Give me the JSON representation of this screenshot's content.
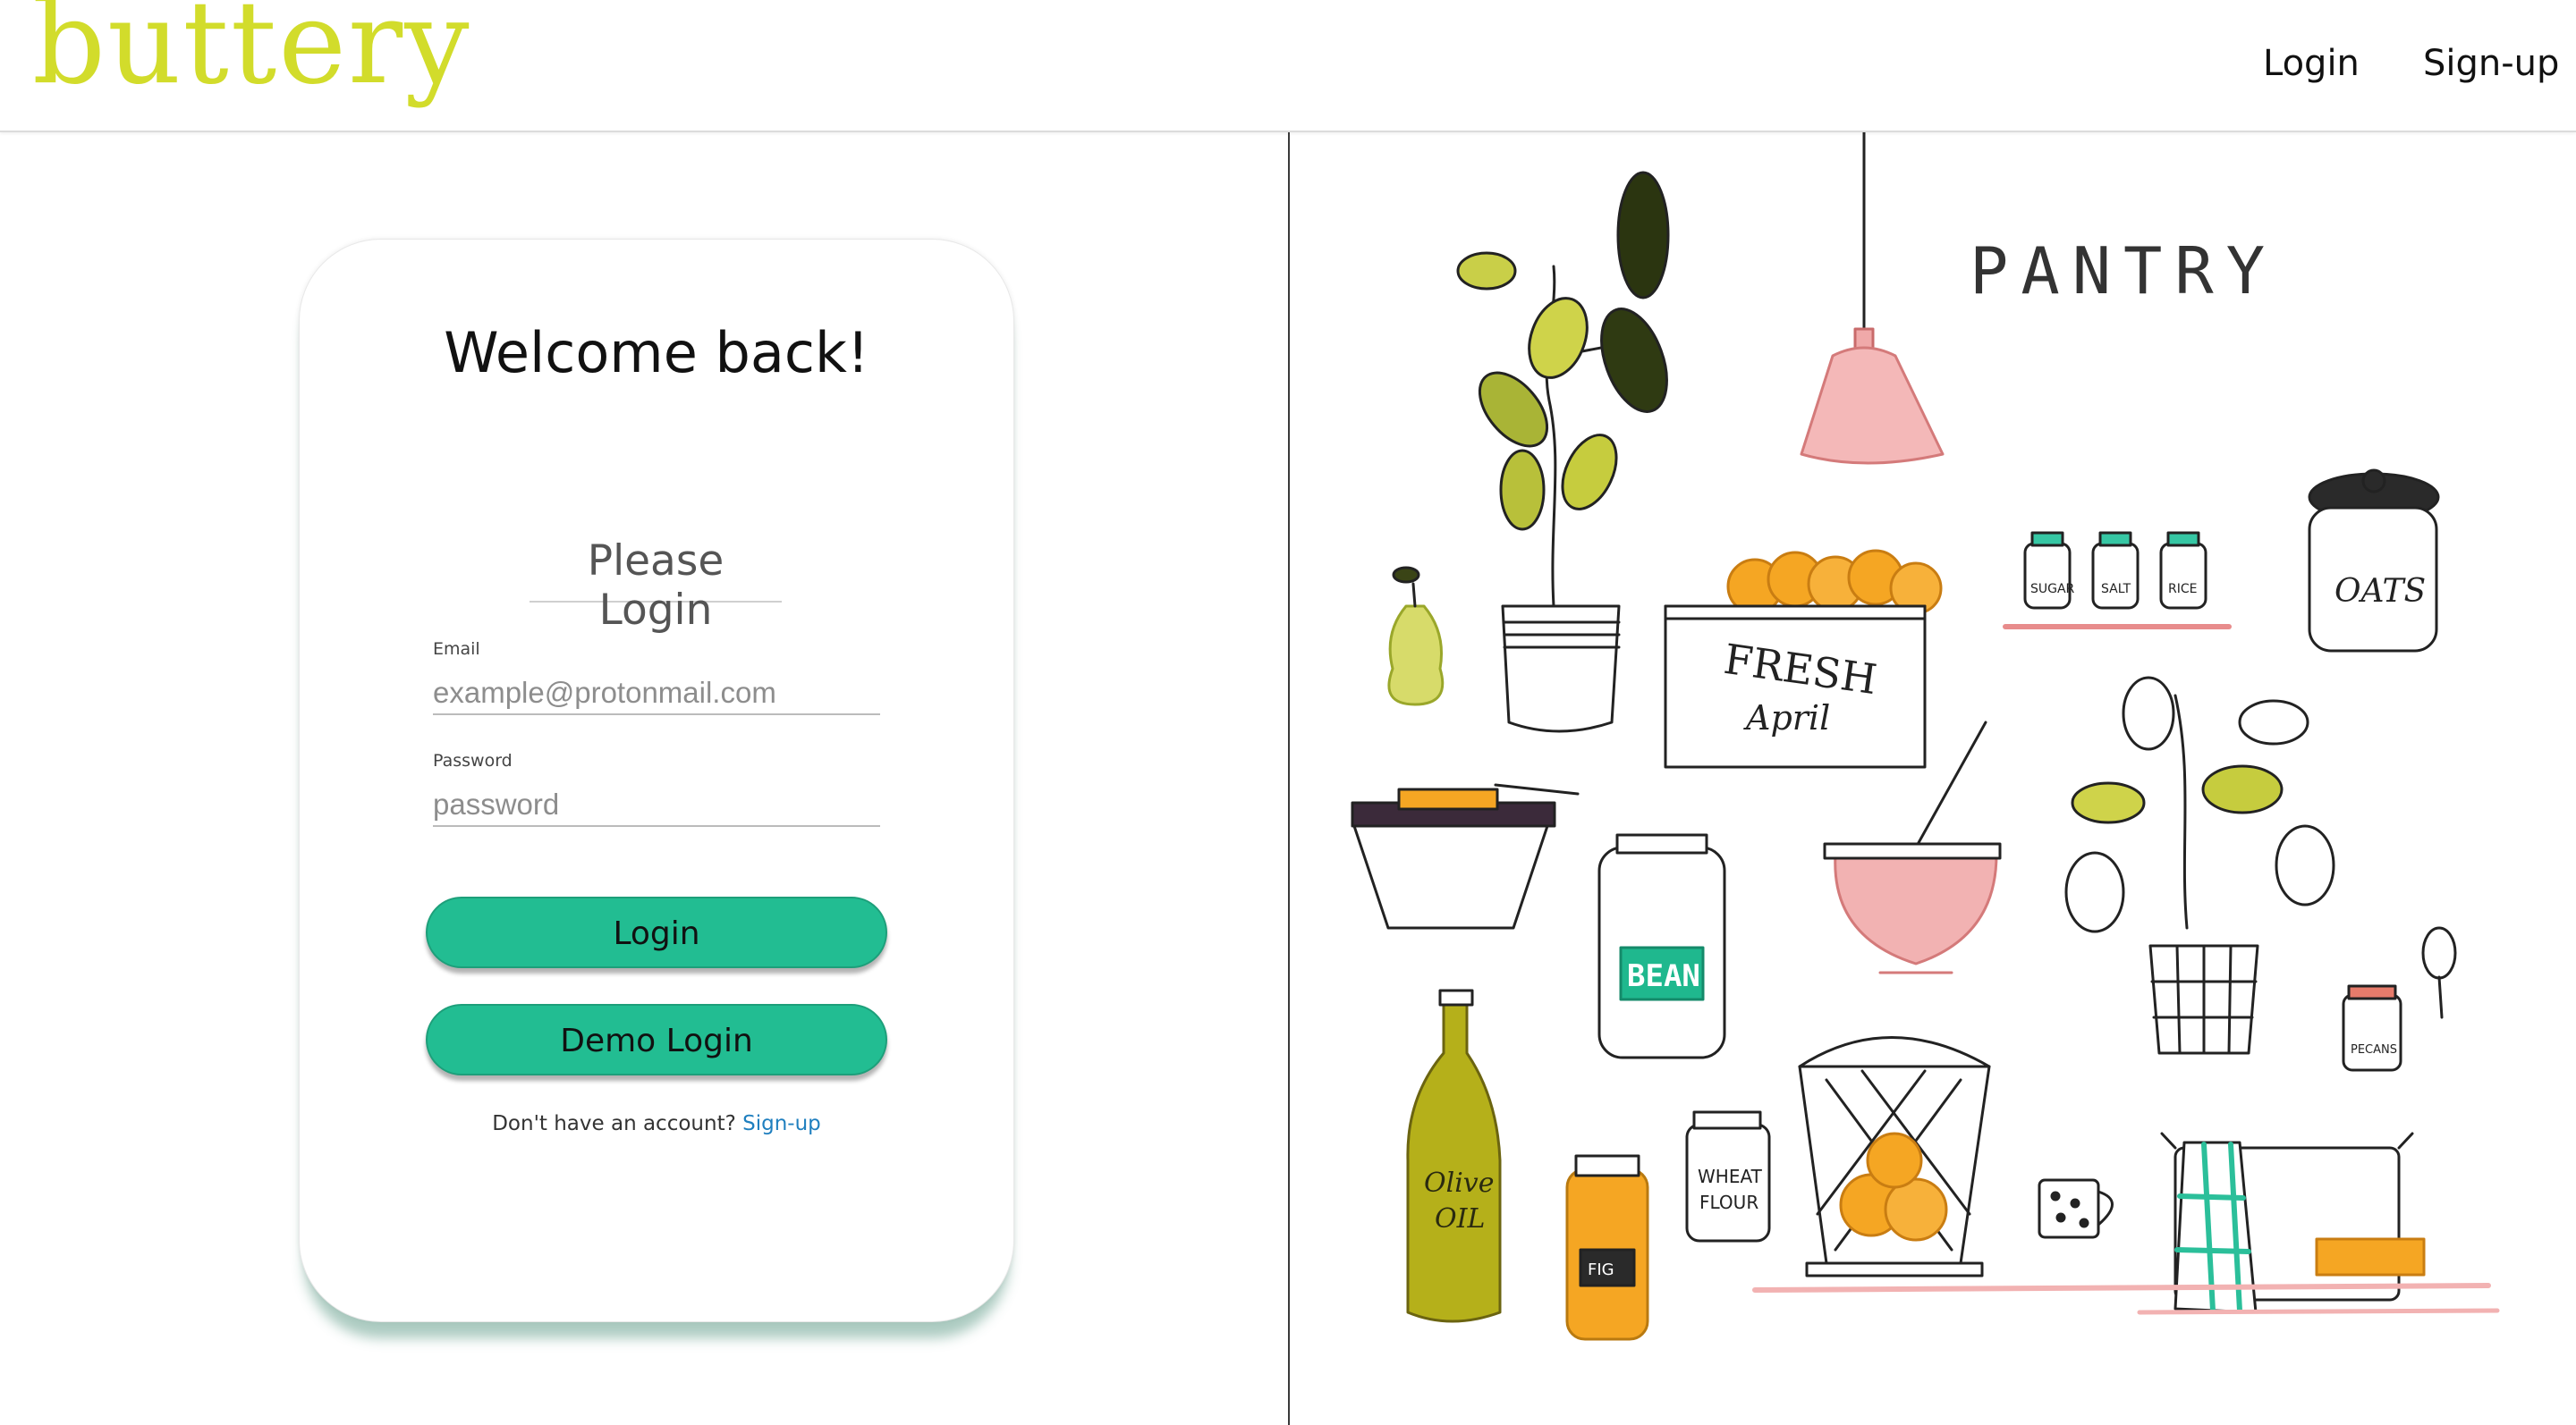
{
  "header": {
    "logo_text": "buttery",
    "nav": {
      "login": "Login",
      "signup": "Sign-up"
    }
  },
  "login_card": {
    "title": "Welcome back!",
    "subtitle": "Please Login",
    "email_label": "Email",
    "email_placeholder": "example@protonmail.com",
    "password_label": "Password",
    "password_placeholder": "password",
    "login_button": "Login",
    "demo_button": "Demo Login",
    "signup_prompt": "Don't have an account?",
    "signup_link": "Sign-up"
  },
  "illustration": {
    "pantry_sign": "PANTRY",
    "crate_word": "FRESH",
    "crate_script": "April",
    "jar_labels": [
      "SUGAR",
      "SALT",
      "RICE"
    ],
    "oats_label": "OATS",
    "bean_label": "BEAN",
    "oil_label_1": "Olive",
    "oil_label_2": "OIL",
    "flour_label_1": "WHEAT",
    "flour_label_2": "FLOUR",
    "small_jar_label": "PECANS",
    "orange_jar_label": "FIG"
  },
  "colors": {
    "brand": "#d2dc2b",
    "accent_button": "#22bd92",
    "link": "#1f7fbf",
    "lamp_pink": "#e88c8c",
    "orange": "#f5a623",
    "leaf_green": "#9aa72a",
    "teal": "#2bbf9a"
  }
}
